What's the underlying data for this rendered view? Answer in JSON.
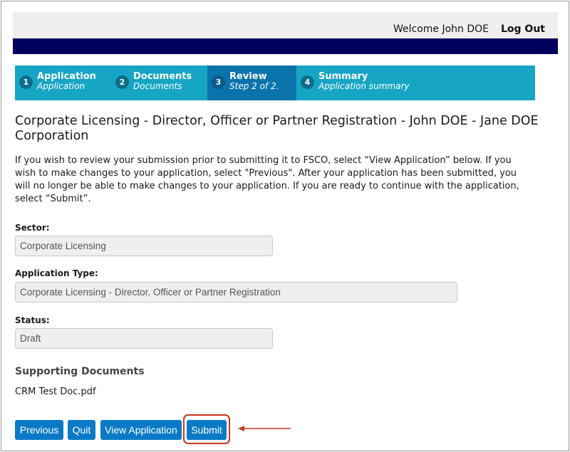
{
  "header": {
    "welcome_text": "Welcome John DOE",
    "logout_label": "Log Out"
  },
  "steps": [
    {
      "number": "1",
      "title": "Application",
      "subtitle": "Application",
      "active": false
    },
    {
      "number": "2",
      "title": "Documents",
      "subtitle": "Documents",
      "active": false
    },
    {
      "number": "3",
      "title": "Review",
      "subtitle": "Step 2 of 2.",
      "active": true
    },
    {
      "number": "4",
      "title": "Summary",
      "subtitle": "Application summary",
      "active": false
    }
  ],
  "page": {
    "title": "Corporate Licensing - Director, Officer or Partner Registration - John DOE - Jane DOE Corporation",
    "intro": "If you wish to review your submission prior to submitting it to FSCO, select “View Application” below. If you wish to make changes to your application, select \"Previous\". After your application has been submitted, you will no longer be able to make changes to your application. If you are ready to continue with the application, select “Submit”."
  },
  "fields": {
    "sector": {
      "label": "Sector:",
      "value": "Corporate Licensing"
    },
    "application_type": {
      "label": "Application Type:",
      "value": "Corporate Licensing - Director, Officer or Partner Registration"
    },
    "status": {
      "label": "Status:",
      "value": "Draft"
    }
  },
  "documents": {
    "heading": "Supporting Documents",
    "items": [
      "CRM Test Doc.pdf"
    ]
  },
  "actions": {
    "previous": "Previous",
    "quit": "Quit",
    "view_application": "View Application",
    "submit": "Submit"
  },
  "colors": {
    "step_bar": "#17a5c5",
    "step_active": "#0a73ab",
    "header_band": "#00005c",
    "button": "#0a7ac7",
    "callout": "#c9361c"
  }
}
